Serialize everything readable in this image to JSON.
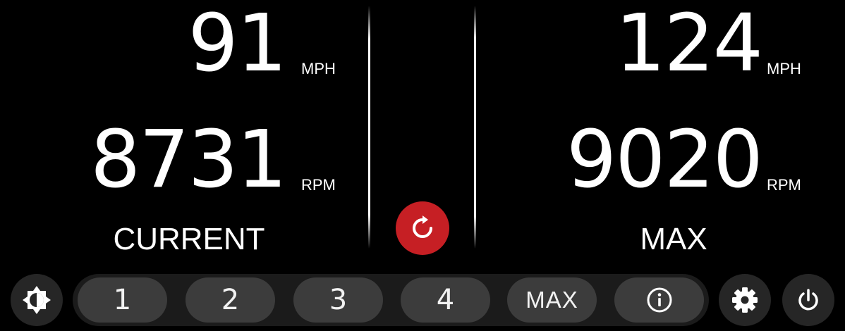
{
  "current": {
    "speed": "91",
    "speed_unit": "MPH",
    "rpm": "8731",
    "rpm_unit": "RPM",
    "label": "CURRENT"
  },
  "max": {
    "speed": "124",
    "speed_unit": "MPH",
    "rpm": "9020",
    "rpm_unit": "RPM",
    "label": "MAX"
  },
  "reset_button": {
    "icon": "refresh-icon",
    "color": "#c61f24"
  },
  "toolbar": {
    "brightness_icon": "brightness-icon",
    "presets": [
      "1",
      "2",
      "3",
      "4"
    ],
    "max_label": "MAX",
    "info_icon": "info-icon",
    "settings_icon": "gear-icon",
    "power_icon": "power-icon"
  }
}
